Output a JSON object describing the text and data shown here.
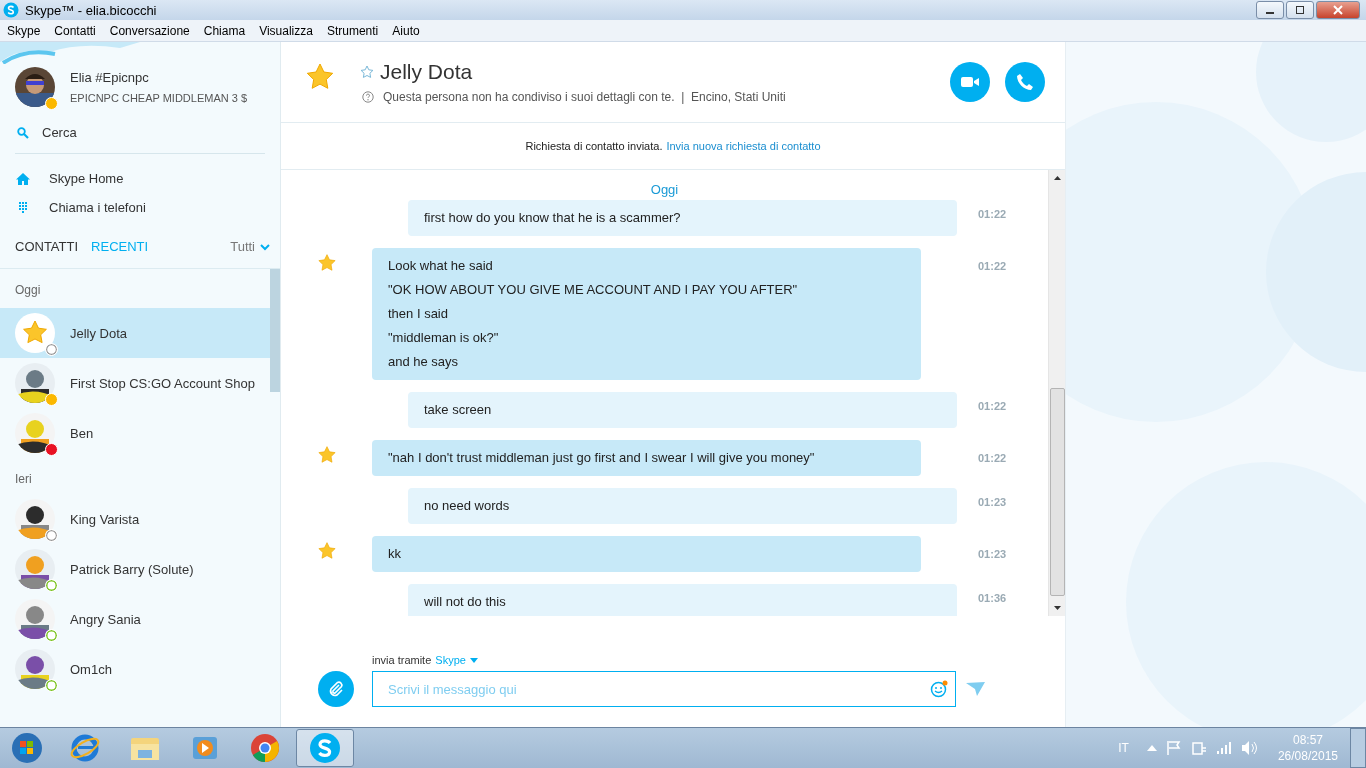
{
  "window": {
    "title": "Skype™ - elia.bicocchi"
  },
  "menu": [
    "Skype",
    "Contatti",
    "Conversazione",
    "Chiama",
    "Visualizza",
    "Strumenti",
    "Aiuto"
  ],
  "profile": {
    "name": "Elia #Epicnpc",
    "mood": "EPICNPC CHEAP MIDDLEMAN 3 $",
    "status": {
      "kind": "away"
    }
  },
  "search": {
    "label": "Cerca"
  },
  "nav": [
    {
      "kind": "home",
      "label": "Skype Home"
    },
    {
      "kind": "dialpad",
      "label": "Chiama i telefoni"
    }
  ],
  "list_tabs": [
    {
      "label": "CONTATTI",
      "selected": false
    },
    {
      "label": "RECENTI",
      "selected": true
    }
  ],
  "filter": {
    "label": "Tutti"
  },
  "groups": [
    {
      "title": "Oggi",
      "contacts": [
        {
          "name": "Jelly Dota",
          "kind": "star",
          "status": {
            "kind": "unknown"
          },
          "selected": true
        },
        {
          "name": "First Stop CS:GO Account Shop",
          "kind": "picture",
          "status": {
            "kind": "away"
          },
          "selected": false
        },
        {
          "name": "Ben",
          "kind": "picture",
          "status": {
            "kind": "dnd"
          },
          "selected": false
        }
      ]
    },
    {
      "title": "Ieri",
      "contacts": [
        {
          "name": "King Varista",
          "kind": "picture",
          "status": {
            "kind": "unknown"
          },
          "selected": false
        },
        {
          "name": "Patrick Barry (Solute)",
          "kind": "picture",
          "status": {
            "kind": "online"
          },
          "selected": false
        },
        {
          "name": "Angry Sania",
          "kind": "picture",
          "status": {
            "kind": "online"
          },
          "selected": false
        },
        {
          "name": "Om1ch",
          "kind": "picture",
          "status": {
            "kind": "online"
          },
          "selected": false
        }
      ]
    }
  ],
  "chat": {
    "name": "Jelly Dota",
    "details": "Questa persona non ha condiviso i suoi dettagli con te.  |  Encino, Stati Uniti",
    "notice": "Richiesta di contatto inviata.",
    "notice_link": "Invia nuova richiesta di contatto",
    "day": "Oggi",
    "messages": [
      {
        "kind": "sent",
        "lines": [
          "first how do you know that he is a scammer?"
        ],
        "time": "01:22"
      },
      {
        "kind": "received",
        "lines": [
          "Look what he said",
          "\"OK HOW ABOUT YOU GIVE ME ACCOUNT AND I PAY YOU AFTER\"",
          "then I said",
          "\"middleman is ok?\"",
          "and he says"
        ],
        "time": "01:22"
      },
      {
        "kind": "sent",
        "lines": [
          "take screen"
        ],
        "time": "01:22"
      },
      {
        "kind": "received",
        "lines": [
          "\"nah I don't trust middleman just go first and I swear I will give you money\""
        ],
        "time": "01:22"
      },
      {
        "kind": "sent",
        "lines": [
          "no need words"
        ],
        "time": "01:23"
      },
      {
        "kind": "received",
        "lines": [
          "kk"
        ],
        "time": "01:23"
      },
      {
        "kind": "sent",
        "lines": [
          "will not do this"
        ],
        "time": "01:36"
      }
    ],
    "via_label": "invia tramite",
    "via_service": "Skype",
    "placeholder": "Scrivi il messaggio qui"
  },
  "taskbar": {
    "apps": [
      {
        "kind": "ie",
        "selected": false
      },
      {
        "kind": "explorer",
        "selected": false
      },
      {
        "kind": "media",
        "selected": false
      },
      {
        "kind": "chrome",
        "selected": false
      },
      {
        "kind": "skype",
        "selected": true
      }
    ],
    "language": "IT",
    "time": "08:57",
    "date": "26/08/2015"
  }
}
